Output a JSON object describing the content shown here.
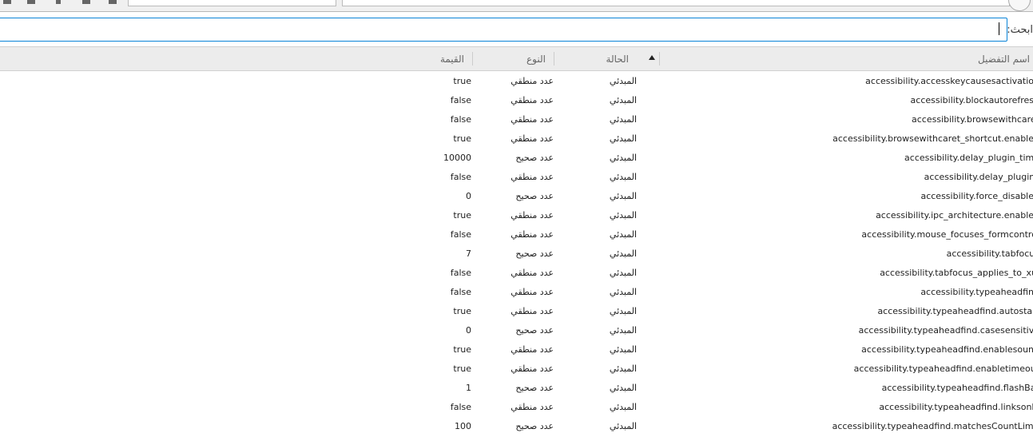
{
  "search": {
    "label": "ابحث:",
    "value": ""
  },
  "columns": {
    "name": "اسم التفضيل",
    "status": "الحالة",
    "type": "النوع",
    "value": "القيمة",
    "sorted_by": "name",
    "sort_direction": "ascending"
  },
  "rows": [
    {
      "name": "accessibility.accesskeycausesactivation",
      "status": "المبدئي",
      "type": "عدد منطقي",
      "value": "true"
    },
    {
      "name": "accessibility.blockautorefresh",
      "status": "المبدئي",
      "type": "عدد منطقي",
      "value": "false"
    },
    {
      "name": "accessibility.browsewithcaret",
      "status": "المبدئي",
      "type": "عدد منطقي",
      "value": "false"
    },
    {
      "name": "accessibility.browsewithcaret_shortcut.enabled",
      "status": "المبدئي",
      "type": "عدد منطقي",
      "value": "true"
    },
    {
      "name": "accessibility.delay_plugin_time",
      "status": "المبدئي",
      "type": "عدد صحيح",
      "value": "10000"
    },
    {
      "name": "accessibility.delay_plugins",
      "status": "المبدئي",
      "type": "عدد منطقي",
      "value": "false"
    },
    {
      "name": "accessibility.force_disabled",
      "status": "المبدئي",
      "type": "عدد صحيح",
      "value": "0"
    },
    {
      "name": "accessibility.ipc_architecture.enabled",
      "status": "المبدئي",
      "type": "عدد منطقي",
      "value": "true"
    },
    {
      "name": "accessibility.mouse_focuses_formcontrol",
      "status": "المبدئي",
      "type": "عدد منطقي",
      "value": "false"
    },
    {
      "name": "accessibility.tabfocus",
      "status": "المبدئي",
      "type": "عدد صحيح",
      "value": "7"
    },
    {
      "name": "accessibility.tabfocus_applies_to_xul",
      "status": "المبدئي",
      "type": "عدد منطقي",
      "value": "false"
    },
    {
      "name": "accessibility.typeaheadfind",
      "status": "المبدئي",
      "type": "عدد منطقي",
      "value": "false"
    },
    {
      "name": "accessibility.typeaheadfind.autostart",
      "status": "المبدئي",
      "type": "عدد منطقي",
      "value": "true"
    },
    {
      "name": "accessibility.typeaheadfind.casesensitive",
      "status": "المبدئي",
      "type": "عدد صحيح",
      "value": "0"
    },
    {
      "name": "accessibility.typeaheadfind.enablesound",
      "status": "المبدئي",
      "type": "عدد منطقي",
      "value": "true"
    },
    {
      "name": "accessibility.typeaheadfind.enabletimeout",
      "status": "المبدئي",
      "type": "عدد منطقي",
      "value": "true"
    },
    {
      "name": "accessibility.typeaheadfind.flashBar",
      "status": "المبدئي",
      "type": "عدد صحيح",
      "value": "1"
    },
    {
      "name": "accessibility.typeaheadfind.linksonly",
      "status": "المبدئي",
      "type": "عدد منطقي",
      "value": "false"
    },
    {
      "name": "accessibility.typeaheadfind.matchesCountLimit",
      "status": "المبدئي",
      "type": "عدد صحيح",
      "value": "100"
    }
  ]
}
